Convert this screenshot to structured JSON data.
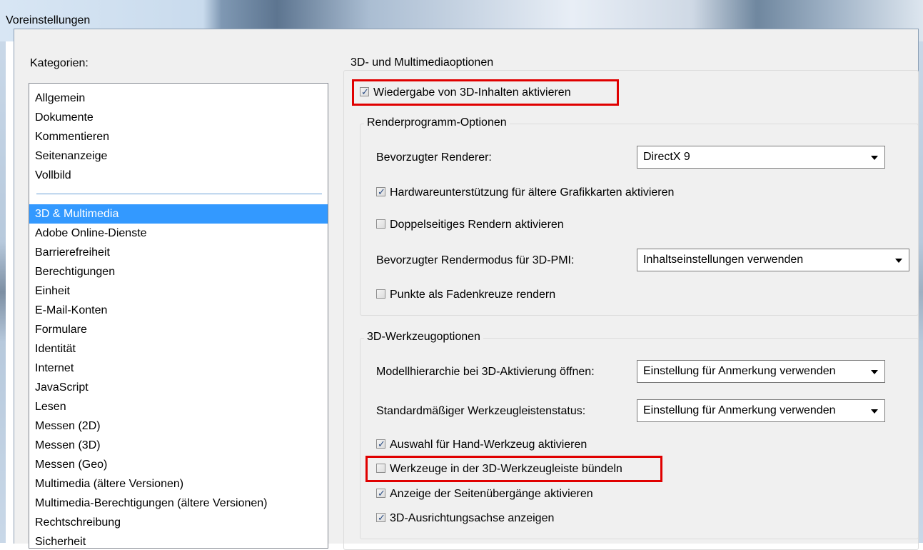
{
  "window": {
    "title": "Voreinstellungen"
  },
  "categories": {
    "label": "Kategorien:",
    "items": [
      "Allgemein",
      "Dokumente",
      "Kommentieren",
      "Seitenanzeige",
      "Vollbild",
      "3D & Multimedia",
      "Adobe Online-Dienste",
      "Barrierefreiheit",
      "Berechtigungen",
      "Einheit",
      "E-Mail-Konten",
      "Formulare",
      "Identität",
      "Internet",
      "JavaScript",
      "Lesen",
      "Messen (2D)",
      "Messen (3D)",
      "Messen (Geo)",
      "Multimedia (ältere Versionen)",
      "Multimedia-Berechtigungen (ältere Versionen)",
      "Rechtschreibung",
      "Sicherheit"
    ],
    "selected": "3D & Multimedia"
  },
  "main": {
    "group_title": "3D- und Multimediaoptionen",
    "enable_3d": {
      "label": "Wiedergabe von 3D-Inhalten aktivieren",
      "checked": true
    },
    "render_options": {
      "title": "Renderprogramm-Optionen",
      "renderer_label": "Bevorzugter Renderer:",
      "renderer_value": "DirectX 9",
      "hw_support": {
        "label": "Hardwareunterstützung für ältere Grafikkarten aktivieren",
        "checked": true
      },
      "double_sided": {
        "label": "Doppelseitiges Rendern aktivieren",
        "checked": false
      },
      "pmi_label": "Bevorzugter Rendermodus für 3D-PMI:",
      "pmi_value": "Inhaltseinstellungen verwenden",
      "crosshair": {
        "label": "Punkte als Fadenkreuze rendern",
        "checked": false
      }
    },
    "tool_options": {
      "title": "3D-Werkzeugoptionen",
      "model_tree_label": "Modellhierarchie bei 3D-Aktivierung öffnen:",
      "model_tree_value": "Einstellung für Anmerkung verwenden",
      "toolbar_state_label": "Standardmäßiger Werkzeugleistenstatus:",
      "toolbar_state_value": "Einstellung für Anmerkung verwenden",
      "hand_tool": {
        "label": "Auswahl für Hand-Werkzeug aktivieren",
        "checked": true
      },
      "bundle_tools": {
        "label": "Werkzeuge in der 3D-Werkzeugleiste bündeln",
        "checked": false
      },
      "page_transitions": {
        "label": "Anzeige der Seitenübergänge aktivieren",
        "checked": true
      },
      "orientation_axis": {
        "label": "3D-Ausrichtungsachse anzeigen",
        "checked": true
      }
    }
  },
  "colors": {
    "selection": "#3399ff",
    "highlight_box": "#e00000"
  }
}
